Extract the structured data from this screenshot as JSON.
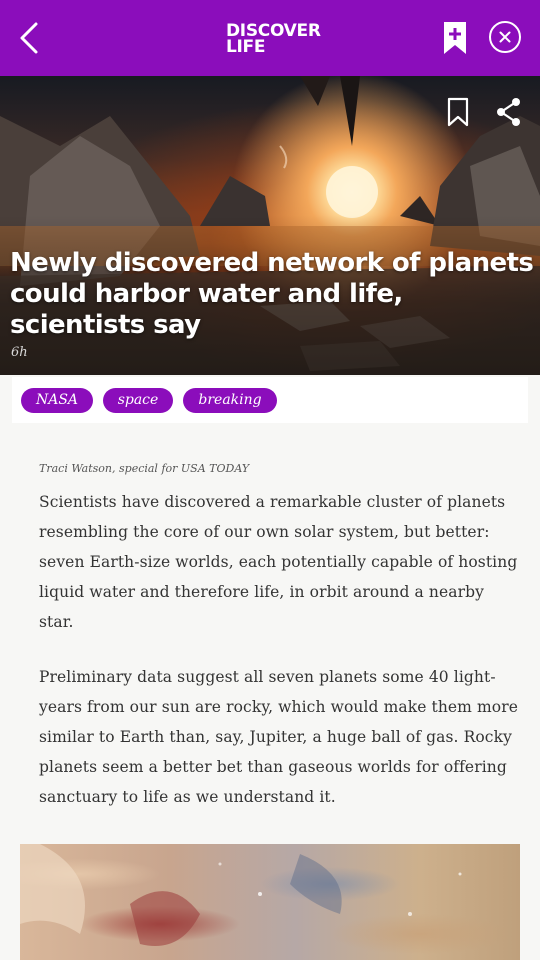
{
  "header": {
    "brand_line1": "DISCOVER",
    "brand_line2": "LIFE",
    "back_icon": "chevron-left-icon",
    "bookmark_icon": "bookmark-add-icon",
    "close_icon": "close-circle-icon"
  },
  "article": {
    "headline": "Newly discovered network of planets could harbor water and life, scientists say",
    "age": "6h",
    "hero_icons": [
      "bookmark-outline-icon",
      "share-icon"
    ],
    "tags": [
      "NASA",
      "space",
      "breaking"
    ],
    "byline": "Traci Watson, special for USA TODAY",
    "paragraphs": [
      "Scientists have discovered a remarkable cluster of planets resembling the core of our own solar system, but better: seven Earth-size worlds, each potentially capable of hosting liquid water and therefore life, in orbit around a nearby star.",
      "Preliminary data suggest all seven planets some 40 light-years from our sun are rocky, which would make them more similar to Earth than, say, Jupiter, a huge ball of gas. Rocky planets seem a better bet than gaseous worlds for offering sanctuary to life as we understand it."
    ]
  },
  "colors": {
    "brand": "#8b0dbb",
    "text": "#333333",
    "background": "#f7f7f5"
  }
}
